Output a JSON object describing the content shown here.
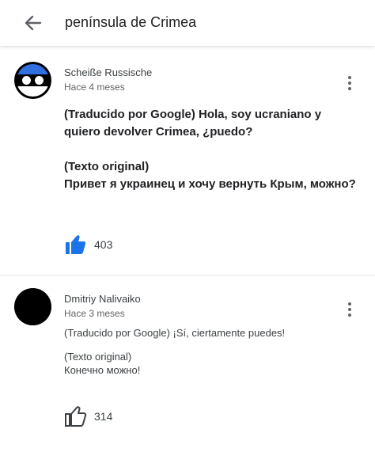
{
  "header": {
    "back_icon": "arrow-left-icon",
    "search_query": "península de Crimea"
  },
  "comments": [
    {
      "author": "Scheiße Russische",
      "time": "Hace 4 meses",
      "translated": "(Traducido por Google) Hola, soy ucraniano y quiero devolver Crimea, ¿puedo?",
      "original_label": "(Texto original)",
      "original": "Привет я украинец и хочу вернуть Крым, можно?",
      "likes": "403",
      "like_icon": "thumbs-up-filled-icon",
      "like_color": "#1a73e8",
      "avatar_icon": "estonia-countryball-avatar-icon"
    },
    {
      "author": "Dmitriy Nalivaiko",
      "time": "Hace 3 meses",
      "translated": "(Traducido por Google) ¡Sí, ciertamente puedes!",
      "original_label": "(Texto original)",
      "original": "Конечно можно!",
      "likes": "314",
      "like_icon": "thumbs-up-outline-icon",
      "avatar_icon": "black-circle-avatar-icon"
    }
  ],
  "menu_icon": "more-vertical-icon"
}
